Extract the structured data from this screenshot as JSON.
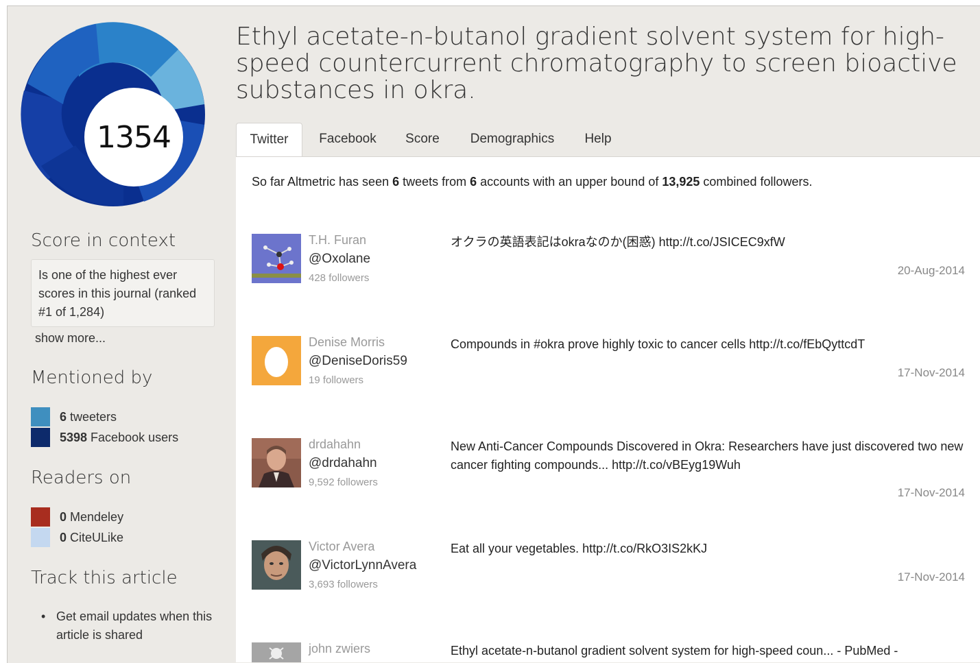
{
  "article": {
    "title": "Ethyl acetate-n-butanol gradient solvent system for high-speed countercurrent chromatography to screen bioactive substances in okra.",
    "score": "1354"
  },
  "sidebar": {
    "score_context": {
      "heading": "Score in context",
      "text": "Is one of the highest ever scores in this journal (ranked #1 of 1,284)",
      "show_more": "show more..."
    },
    "mentioned_by": {
      "heading": "Mentioned by",
      "items": [
        {
          "count": "6",
          "label": "tweeters",
          "color": "#3f8fbf"
        },
        {
          "count": "5398",
          "label": "Facebook users",
          "color": "#0d2a6b"
        }
      ]
    },
    "readers_on": {
      "heading": "Readers on",
      "items": [
        {
          "count": "0",
          "label": "Mendeley",
          "color": "#a82d1f"
        },
        {
          "count": "0",
          "label": "CiteULike",
          "color": "#c4d8f0"
        }
      ]
    },
    "track": {
      "heading": "Track this article",
      "items": [
        "Get email updates when this article is shared"
      ]
    }
  },
  "tabs": [
    {
      "label": "Twitter",
      "active": true
    },
    {
      "label": "Facebook",
      "active": false
    },
    {
      "label": "Score",
      "active": false
    },
    {
      "label": "Demographics",
      "active": false
    },
    {
      "label": "Help",
      "active": false
    }
  ],
  "twitter": {
    "summary": {
      "prefix": "So far Altmetric has seen ",
      "tweets": "6",
      "mid1": " tweets from ",
      "accounts": "6",
      "mid2": " accounts with an upper bound of ",
      "followers": "13,925",
      "suffix": " combined followers."
    },
    "tweets": [
      {
        "name": "T.H. Furan",
        "handle": "@Oxolane",
        "followers": "428 followers",
        "text": "オクラの英語表記はokraなのか(困惑) http://t.co/JSICEC9xfW",
        "date": "20-Aug-2014",
        "avatar_icon": "molecule-avatar-icon"
      },
      {
        "name": "Denise Morris",
        "handle": "@DeniseDoris59",
        "followers": "19 followers",
        "text": "Compounds in #okra prove highly toxic to cancer cells http://t.co/fEbQyttcdT",
        "date": "17-Nov-2014",
        "avatar_icon": "egg-avatar-icon"
      },
      {
        "name": "drdahahn",
        "handle": "@drdahahn",
        "followers": "9,592 followers",
        "text": "New Anti-Cancer Compounds Discovered in Okra: Researchers have just discovered two new cancer fighting compounds... http://t.co/vBEyg19Wuh",
        "date": "17-Nov-2014",
        "avatar_icon": "portrait-avatar-icon"
      },
      {
        "name": "Victor Avera",
        "handle": "@VictorLynnAvera",
        "followers": "3,693 followers",
        "text": "Eat all your vegetables. http://t.co/RkO3IS2kKJ",
        "date": "17-Nov-2014",
        "avatar_icon": "portrait-avatar-icon"
      },
      {
        "name": "john zwiers",
        "handle": "",
        "followers": "",
        "text": "Ethyl acetate-n-butanol gradient solvent system for high-speed coun... - PubMed -",
        "date": "",
        "avatar_icon": "skull-avatar-icon"
      }
    ]
  }
}
